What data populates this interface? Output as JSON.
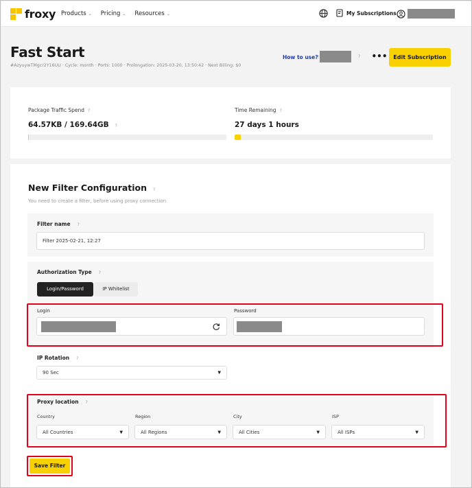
{
  "header": {
    "logo_text": "froxy",
    "nav": [
      {
        "label": "Products"
      },
      {
        "label": "Pricing"
      },
      {
        "label": "Resources"
      }
    ],
    "subscriptions_label": "My Subscriptions"
  },
  "page": {
    "title": "Fast Start",
    "meta": "#AzyuywTMgcr2Y16UU  ·  Cycle: month  ·  Ports: 1000  ·  Prolongation: 2025-03-20, 13:50:42  ·  Next Billing: $0",
    "how_to_use": "How to use?",
    "more_label": "•••",
    "edit_button": "Edit Subscription"
  },
  "stats": {
    "traffic_label": "Package Traffic Spend",
    "traffic_value": "64.57KB / 169.64GB",
    "traffic_fraction": 0.0004,
    "time_label": "Time Remaining",
    "time_value": "27 days 1 hours",
    "time_fraction": 0.03
  },
  "filter": {
    "title": "New Filter Configuration",
    "subtitle": "You need to create a filter, before using proxy connection",
    "name_label": "Filter name",
    "name_value": "Filter 2025-02-21, 12:27",
    "auth_label": "Authorization Type",
    "auth_tabs": [
      "Login/Password",
      "IP Whitelist"
    ],
    "login_label": "Login",
    "password_label": "Password",
    "rotation_label": "IP Rotation",
    "rotation_value": "90 Sec",
    "location_label": "Proxy location",
    "country_label": "Country",
    "country_value": "All Countries",
    "region_label": "Region",
    "region_value": "All Regions",
    "city_label": "City",
    "city_value": "All Cities",
    "isp_label": "ISP",
    "isp_value": "All ISPs",
    "save_button": "Save Filter"
  },
  "help_glyph": "?",
  "colors": {
    "accent": "#f9d100",
    "highlight": "#e3001b",
    "link": "#1e3ca8"
  }
}
